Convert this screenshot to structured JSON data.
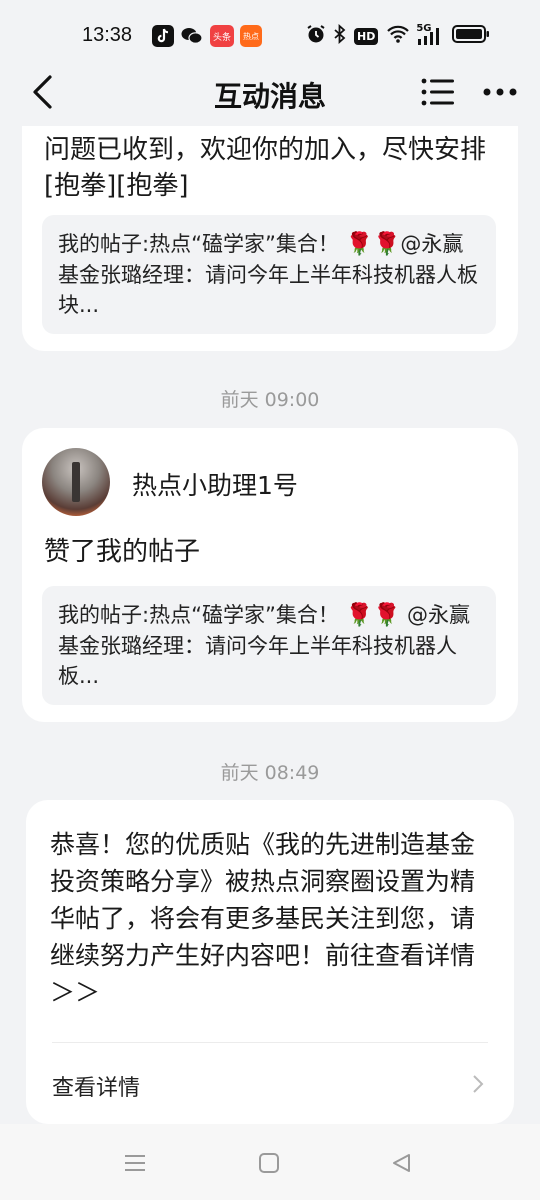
{
  "status_bar": {
    "time": "13:38",
    "apps": [
      {
        "icon": "tiktok-icon",
        "color": "#111111"
      },
      {
        "icon": "wechat-icon",
        "color": "#111111"
      },
      {
        "icon": "toutiao-icon",
        "color": "#f04142",
        "text": "头条"
      },
      {
        "icon": "app-orange-icon",
        "color": "#ff6a1a",
        "text": "热点"
      }
    ],
    "hd_label": "HD",
    "network_label": "5G"
  },
  "nav": {
    "title": "互动消息"
  },
  "messages": [
    {
      "text": "问题已收到，欢迎你的加入，尽快安排[抱拳][抱拳]",
      "quote_prefix": "我的帖子:热点“磕学家”集合！",
      "quote_suffix": "@永赢基金张璐经理：请问今年上半年科技机器人板块..."
    }
  ],
  "timestamps": [
    "前天 09:00",
    "前天 08:49"
  ],
  "like_card": {
    "username": "热点小助理1号",
    "action": "赞了我的帖子",
    "quote_prefix": "我的帖子:热点“磕学家”集合！",
    "quote_suffix": "@永赢基金张璐经理：请问今年上半年科技机器人板..."
  },
  "notice_card": {
    "text": "恭喜！您的优质贴《我的先进制造基金投资策略分享》被热点洞察圈设置为精华帖了，将会有更多基民关注到您，请继续努力产生好内容吧！前往查看详情＞＞",
    "link_label": "查看详情"
  },
  "flower_glyph": "🌹",
  "colors": {
    "background": "#f2f3f5",
    "card": "#ffffff",
    "quote_bg": "#f2f3f5",
    "timestamp": "#9a9a9a"
  }
}
